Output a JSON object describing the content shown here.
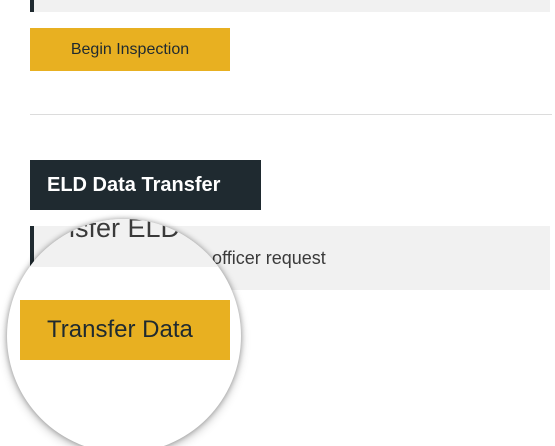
{
  "inspection": {
    "begin_label": "Begin Inspection"
  },
  "eld_transfer": {
    "title": "ELD Data Transfer",
    "info_text": "a upon officer request",
    "magnified_text": "isfer ELD",
    "transfer_label": "Transfer Data"
  },
  "colors": {
    "accent": "#e8b021",
    "dark": "#1f2a30",
    "panel": "#f1f1f1"
  }
}
